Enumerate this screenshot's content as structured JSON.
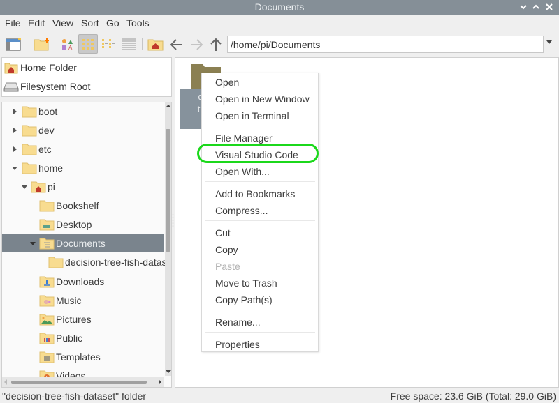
{
  "window": {
    "title": "Documents",
    "controls": [
      "minimize",
      "maximize",
      "close"
    ]
  },
  "menubar": [
    "File",
    "Edit",
    "View",
    "Sort",
    "Go",
    "Tools"
  ],
  "toolbar": {
    "buttons": [
      {
        "name": "new-window",
        "icon": "new-window-icon"
      },
      {
        "name": "new-folder",
        "icon": "new-folder-icon"
      },
      {
        "name": "icon-view",
        "icon": "icon-view-icon"
      },
      {
        "name": "thumbnail-view",
        "icon": "thumbnail-view-icon",
        "active": true
      },
      {
        "name": "compact-view",
        "icon": "compact-view-icon"
      },
      {
        "name": "detailed-list-view",
        "icon": "detailed-list-view-icon"
      },
      {
        "name": "home",
        "icon": "home-folder-icon"
      },
      {
        "name": "back",
        "icon": "arrow-left-icon"
      },
      {
        "name": "forward",
        "icon": "arrow-right-icon",
        "disabled": true
      },
      {
        "name": "up",
        "icon": "arrow-up-icon"
      }
    ],
    "path": "/home/pi/Documents"
  },
  "places": [
    {
      "label": "Home Folder",
      "icon": "home-folder-icon"
    },
    {
      "label": "Filesystem Root",
      "icon": "drive-icon"
    }
  ],
  "tree": [
    {
      "label": "boot",
      "depth": 0,
      "expander": "collapsed",
      "icon": "folder-icon"
    },
    {
      "label": "dev",
      "depth": 0,
      "expander": "collapsed",
      "icon": "folder-icon"
    },
    {
      "label": "etc",
      "depth": 0,
      "expander": "collapsed",
      "icon": "folder-icon"
    },
    {
      "label": "home",
      "depth": 0,
      "expander": "expanded",
      "icon": "folder-icon"
    },
    {
      "label": "pi",
      "depth": 1,
      "expander": "expanded",
      "icon": "home-folder-icon"
    },
    {
      "label": "Bookshelf",
      "depth": 2,
      "expander": "none",
      "icon": "folder-icon"
    },
    {
      "label": "Desktop",
      "depth": 2,
      "expander": "none",
      "icon": "desktop-folder-icon"
    },
    {
      "label": "Documents",
      "depth": 2,
      "expander": "expanded",
      "icon": "documents-folder-icon",
      "selected": true
    },
    {
      "label": "decision-tree-fish-datas",
      "depth": 3,
      "expander": "none",
      "icon": "folder-icon"
    },
    {
      "label": "Downloads",
      "depth": 2,
      "expander": "none",
      "icon": "downloads-folder-icon"
    },
    {
      "label": "Music",
      "depth": 2,
      "expander": "none",
      "icon": "music-folder-icon"
    },
    {
      "label": "Pictures",
      "depth": 2,
      "expander": "none",
      "icon": "pictures-folder-icon"
    },
    {
      "label": "Public",
      "depth": 2,
      "expander": "none",
      "icon": "public-folder-icon"
    },
    {
      "label": "Templates",
      "depth": 2,
      "expander": "none",
      "icon": "templates-folder-icon"
    },
    {
      "label": "Videos",
      "depth": 2,
      "expander": "none",
      "icon": "videos-folder-icon"
    }
  ],
  "files": [
    {
      "label_lines": [
        "dec",
        "tree",
        "da"
      ],
      "full_name": "decision-tree-fish-dataset",
      "selected": true
    }
  ],
  "context_menu": {
    "groups": [
      [
        {
          "label": "Open"
        },
        {
          "label": "Open in New Window"
        },
        {
          "label": "Open in Terminal"
        }
      ],
      [
        {
          "label": "File Manager"
        },
        {
          "label": "Visual Studio Code",
          "highlighted": true
        },
        {
          "label": "Open With..."
        }
      ],
      [
        {
          "label": "Add to Bookmarks"
        },
        {
          "label": "Compress..."
        }
      ],
      [
        {
          "label": "Cut"
        },
        {
          "label": "Copy"
        },
        {
          "label": "Paste",
          "disabled": true
        },
        {
          "label": "Move to Trash"
        },
        {
          "label": "Copy Path(s)"
        }
      ],
      [
        {
          "label": "Rename..."
        }
      ],
      [
        {
          "label": "Properties"
        }
      ]
    ]
  },
  "statusbar": {
    "selection": "\"decision-tree-fish-dataset\" folder",
    "free_space": "Free space: 23.6 GiB (Total: 29.0 GiB)"
  },
  "colors": {
    "titlebar": "#858f97",
    "selection": "#7a848d",
    "highlight_ring": "#1bd81b",
    "folder": "#f8dc90"
  }
}
